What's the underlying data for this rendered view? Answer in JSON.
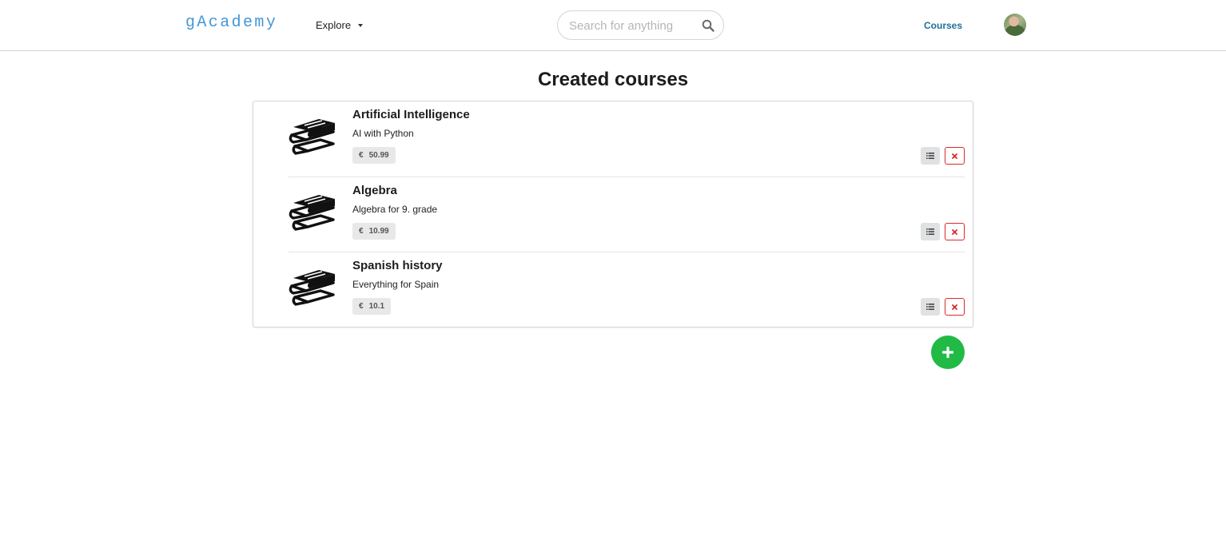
{
  "brand": {
    "name": "gAcademy",
    "color": "#2185d0"
  },
  "nav": {
    "explore_label": "Explore",
    "search_placeholder": "Search for anything",
    "courses_link": "Courses"
  },
  "page": {
    "title": "Created courses"
  },
  "courses": [
    {
      "title": "Artificial Intelligence",
      "description": "AI with Python",
      "currency": "€",
      "price": "50.99"
    },
    {
      "title": "Algebra",
      "description": "Algebra for 9. grade",
      "currency": "€",
      "price": "10.99"
    },
    {
      "title": "Spanish history",
      "description": "Everything for Spain",
      "currency": "€",
      "price": "10.1"
    }
  ],
  "icons": {
    "course": "book-stack-icon",
    "search": "search-icon",
    "list_button": "list-icon",
    "delete_button": "close-icon",
    "add_button": "plus-icon"
  },
  "colors": {
    "danger": "#db2828",
    "success": "#21ba45",
    "link": "#1f6f9a"
  }
}
